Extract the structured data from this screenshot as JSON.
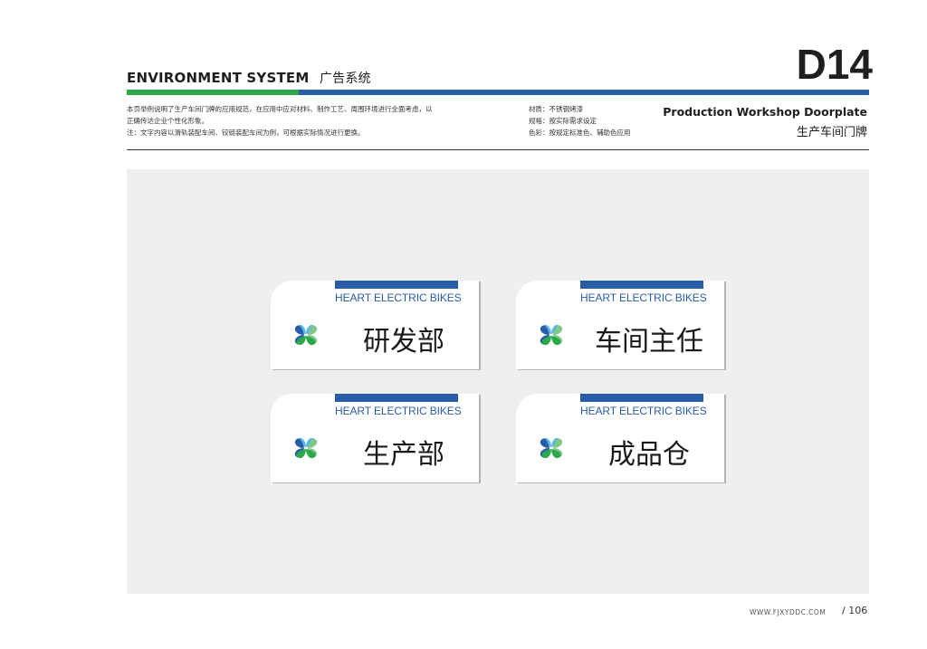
{
  "header": {
    "section_en": "ENVIRONMENT SYSTEM",
    "section_cn": "广告系统",
    "code": "D14"
  },
  "description": {
    "line1": "本页举例说明了生产车间门牌的应用规范，在应用中应对材料、制作工艺、周围环境进行全面考虑，以",
    "line2": "正确传达企业个性化形象。",
    "line3": "注：文字内容以滑轨装配车间、铰链装配车间为例，可根据实际情况进行更换。"
  },
  "specs": {
    "material": "材质：不锈钢烤漆",
    "size": "规格：按实际需求设定",
    "color": "色彩：按规定标准色、辅助色应用"
  },
  "title": {
    "en": "Production Workshop Doorplate",
    "cn": "生产车间门牌"
  },
  "signs": [
    {
      "brand": "HEART ELECTRIC BIKES",
      "dept": "研发部"
    },
    {
      "brand": "HEART ELECTRIC BIKES",
      "dept": "车间主任"
    },
    {
      "brand": "HEART ELECTRIC BIKES",
      "dept": "生产部"
    },
    {
      "brand": "HEART ELECTRIC BIKES",
      "dept": "成品仓"
    }
  ],
  "footer": {
    "url": "WWW.FJXYDDC.COM",
    "page": "/ 106"
  },
  "colors": {
    "brand_blue": "#2a5da8",
    "brand_green": "#2aa84a",
    "panel_gray": "#efefef"
  }
}
